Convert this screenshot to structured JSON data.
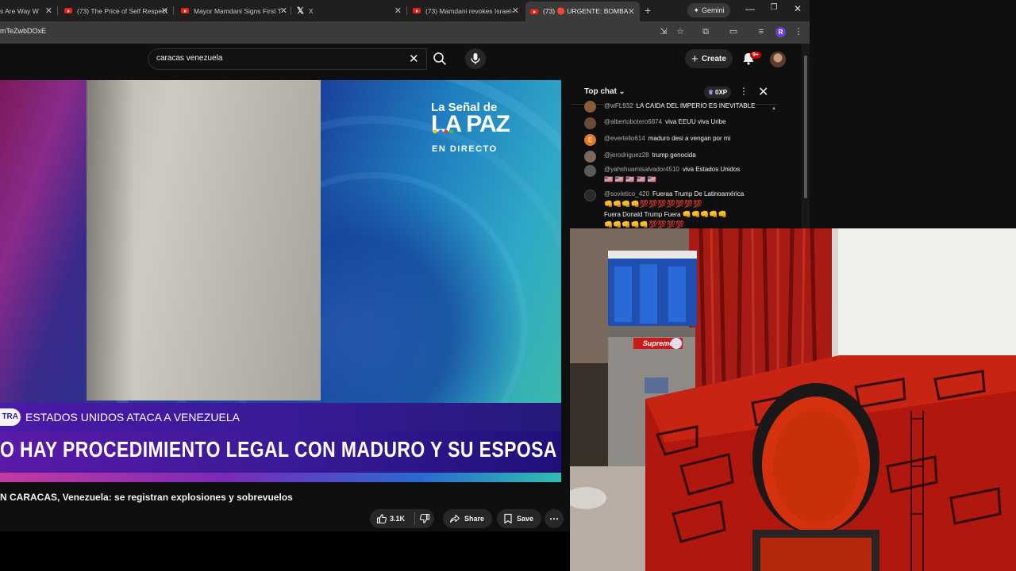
{
  "browser": {
    "tabs": [
      {
        "title": "s Are Way W"
      },
      {
        "title": "(73) The Price of Self Respect"
      },
      {
        "title": "Mayor Mamdani Signs First T"
      },
      {
        "title": "X"
      },
      {
        "title": "(73) Mamdani revokes Israel-"
      },
      {
        "title": "(73) 🔴 URGENTE: BOMBA"
      }
    ],
    "new_tab": "+",
    "gemini_label": "Gemini",
    "url": "mTeZwbDOxE",
    "profile_initial": "R"
  },
  "youtube": {
    "search_value": "caracas venezuela",
    "create_label": "Create",
    "notification_count": "9+"
  },
  "video": {
    "logo_line1": "La Señal de",
    "logo_line2": "LA PAZ",
    "logo_line3": "EN DIRECTO",
    "live_tag": "TRA",
    "ticker_top": "ESTADOS UNIDOS ATACA A VENEZUELA",
    "ticker_main": "O HAY PROCEDIMIENTO LEGAL CON MADURO Y SU ESPOSA",
    "title": "N CARACAS, Venezuela: se registran explosiones y sobrevuelos",
    "like_count": "3.1K",
    "share_label": "Share",
    "save_label": "Save"
  },
  "chat": {
    "header": "Top chat",
    "xp": "0XP",
    "messages": [
      {
        "author": "@wFL932",
        "text": "LA CAIDA DEL IMPERIO ES INEVITABLE",
        "avatar_color": "#8a5a3a",
        "avatar_letter": ""
      },
      {
        "author": "@albertobotero6874",
        "text": "viva EEUU viva Uribe",
        "avatar_color": "#6a4a3a",
        "avatar_letter": ""
      },
      {
        "author": "@evertello614",
        "text": "maduro desi a vengan por mi",
        "avatar_color": "#e07a2a",
        "avatar_letter": "E"
      },
      {
        "author": "@jerodriguez28",
        "text": "trump genocida",
        "avatar_color": "#7a6a5a",
        "avatar_letter": ""
      },
      {
        "author": "@yahshuamisalvador4510",
        "text": "viva Estados Unidos",
        "avatar_color": "#5a5a5a",
        "avatar_letter": ""
      },
      {
        "author": "@sovietico_420",
        "text": "Fueraa Trump De Latinoamérica",
        "avatar_color": "#2a2a2a",
        "avatar_letter": ""
      },
      {
        "author": "",
        "text": "Fuera Donald Trump Fuera",
        "avatar_color": "",
        "avatar_letter": ""
      }
    ]
  },
  "webcam": {
    "sticker_text": "Supreme"
  },
  "colors": {
    "yt_bg": "#0f0f0f",
    "ticker_purple": "#3a1a98",
    "chrome_tab": "#3b3b3b"
  }
}
